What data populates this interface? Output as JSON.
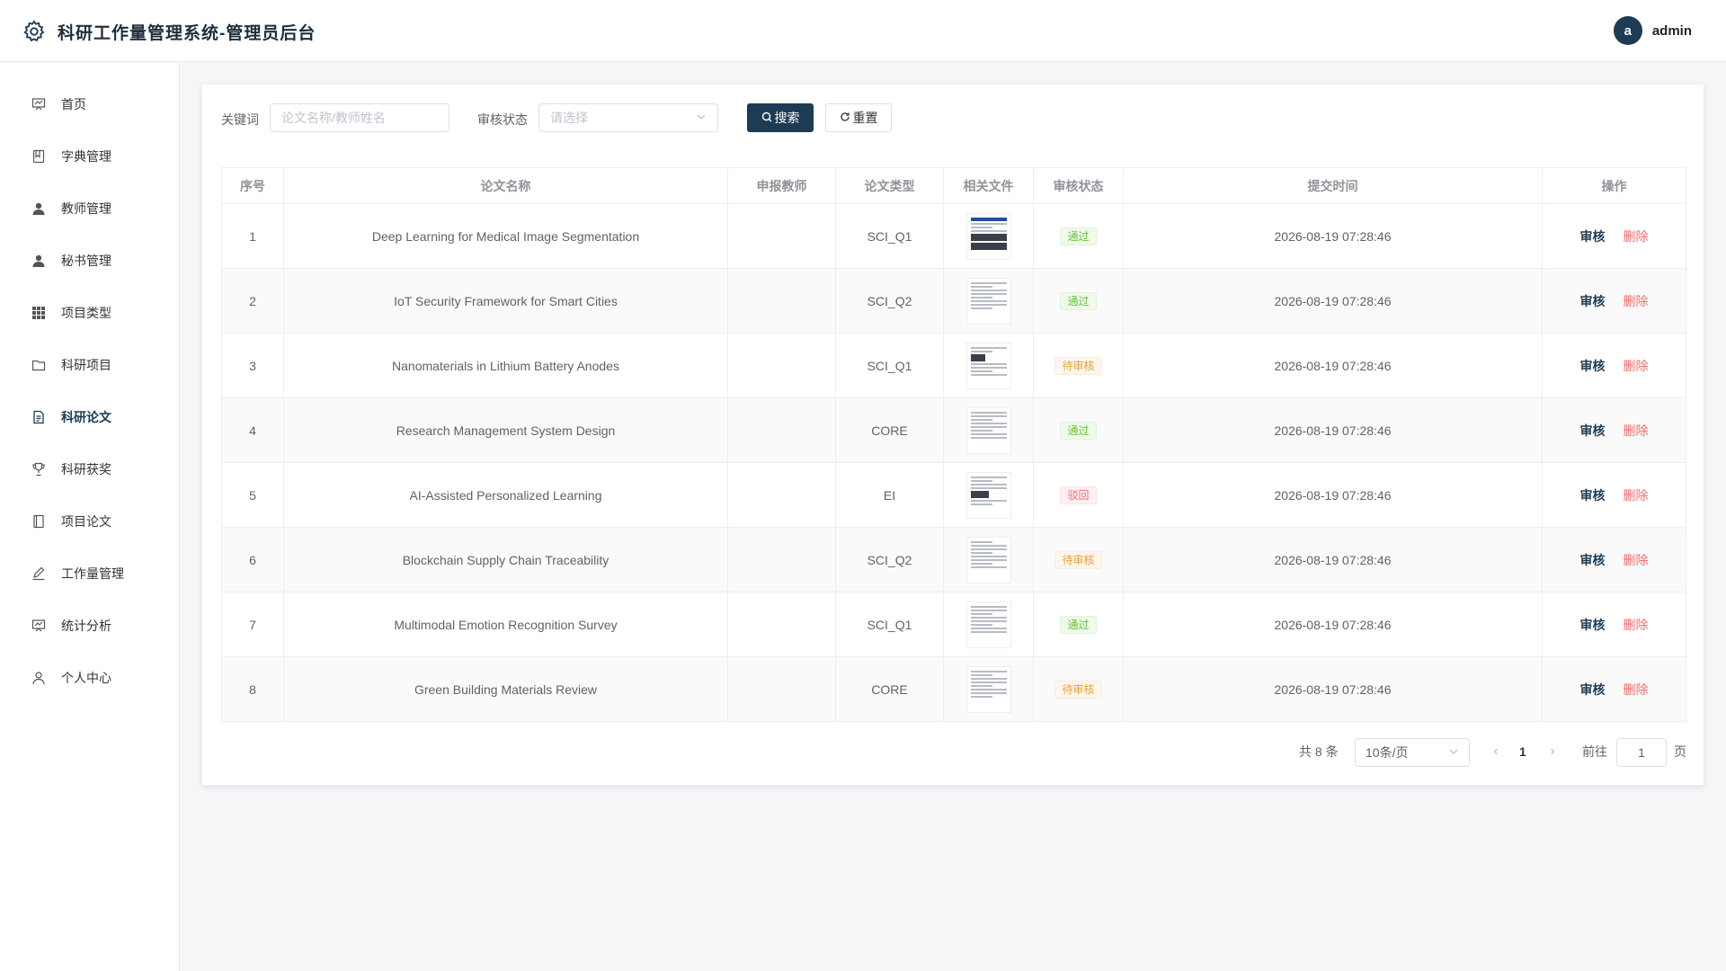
{
  "app": {
    "title": "科研工作量管理系统-管理员后台"
  },
  "user": {
    "avatar_letter": "a",
    "name": "admin"
  },
  "sidebar": {
    "items": [
      {
        "label": "首页",
        "icon": "dashboard-icon",
        "active": false
      },
      {
        "label": "字典管理",
        "icon": "book-icon",
        "active": false
      },
      {
        "label": "教师管理",
        "icon": "user-icon",
        "active": false
      },
      {
        "label": "秘书管理",
        "icon": "user-icon",
        "active": false
      },
      {
        "label": "项目类型",
        "icon": "grid-icon",
        "active": false
      },
      {
        "label": "科研项目",
        "icon": "folder-icon",
        "active": false
      },
      {
        "label": "科研论文",
        "icon": "document-icon",
        "active": true
      },
      {
        "label": "科研获奖",
        "icon": "trophy-icon",
        "active": false
      },
      {
        "label": "项目论文",
        "icon": "notebook-icon",
        "active": false
      },
      {
        "label": "工作量管理",
        "icon": "edit-icon",
        "active": false
      },
      {
        "label": "统计分析",
        "icon": "chart-icon",
        "active": false
      },
      {
        "label": "个人中心",
        "icon": "user-outline-icon",
        "active": false
      }
    ]
  },
  "filters": {
    "keyword_label": "关键词",
    "keyword_placeholder": "论文名称/教师姓名",
    "status_label": "审核状态",
    "status_placeholder": "请选择",
    "search_label": "搜索",
    "reset_label": "重置"
  },
  "table": {
    "columns": [
      "序号",
      "论文名称",
      "申报教师",
      "论文类型",
      "相关文件",
      "审核状态",
      "提交时间",
      "操作"
    ],
    "rows": [
      {
        "no": "1",
        "title": "Deep Learning for Medical Image Segmentation",
        "teacher": "",
        "type": "SCI_Q1",
        "status": "通过",
        "status_kind": "success",
        "time": "2026-08-19 07:28:46"
      },
      {
        "no": "2",
        "title": "IoT Security Framework for Smart Cities",
        "teacher": "",
        "type": "SCI_Q2",
        "status": "通过",
        "status_kind": "success",
        "time": "2026-08-19 07:28:46"
      },
      {
        "no": "3",
        "title": "Nanomaterials in Lithium Battery Anodes",
        "teacher": "",
        "type": "SCI_Q1",
        "status": "待审核",
        "status_kind": "warning",
        "time": "2026-08-19 07:28:46"
      },
      {
        "no": "4",
        "title": "Research Management System Design",
        "teacher": "",
        "type": "CORE",
        "status": "通过",
        "status_kind": "success",
        "time": "2026-08-19 07:28:46"
      },
      {
        "no": "5",
        "title": "AI-Assisted Personalized Learning",
        "teacher": "",
        "type": "EI",
        "status": "驳回",
        "status_kind": "danger",
        "time": "2026-08-19 07:28:46"
      },
      {
        "no": "6",
        "title": "Blockchain Supply Chain Traceability",
        "teacher": "",
        "type": "SCI_Q2",
        "status": "待审核",
        "status_kind": "warning",
        "time": "2026-08-19 07:28:46"
      },
      {
        "no": "7",
        "title": "Multimodal Emotion Recognition Survey",
        "teacher": "",
        "type": "SCI_Q1",
        "status": "通过",
        "status_kind": "success",
        "time": "2026-08-19 07:28:46"
      },
      {
        "no": "8",
        "title": "Green Building Materials Review",
        "teacher": "",
        "type": "CORE",
        "status": "待审核",
        "status_kind": "warning",
        "time": "2026-08-19 07:28:46"
      }
    ],
    "action_audit": "审核",
    "action_delete": "删除"
  },
  "pagination": {
    "total_text": "共 8 条",
    "page_size": "10条/页",
    "current_page": "1",
    "goto_label": "前往",
    "goto_value": "1",
    "page_suffix": "页"
  },
  "colors": {
    "primary": "#1d3b55",
    "success": "#67c23a",
    "warning": "#e6a23c",
    "danger": "#f56c6c"
  }
}
